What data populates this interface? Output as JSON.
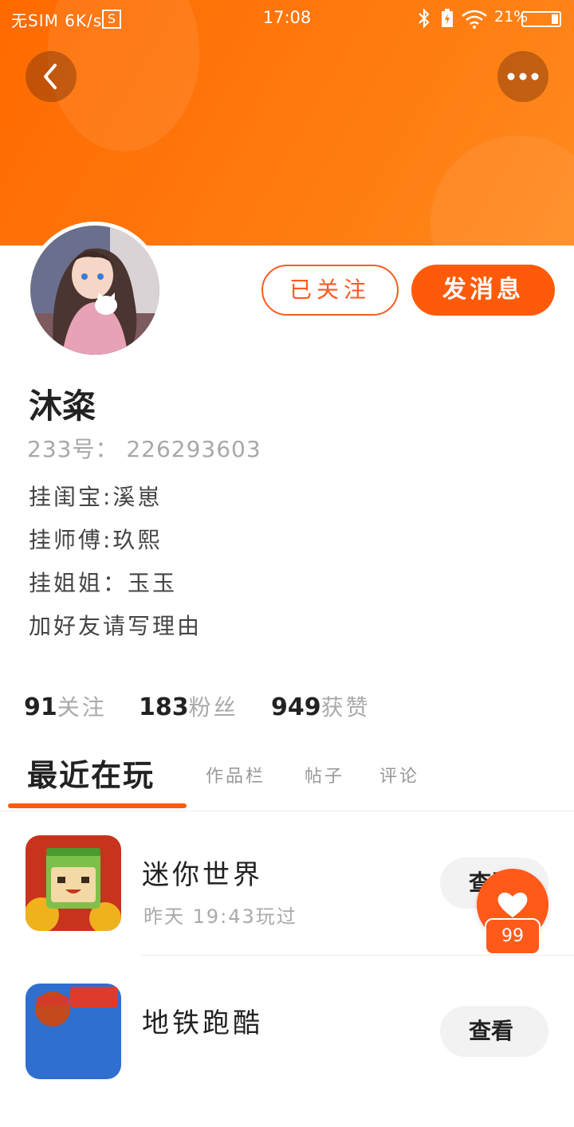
{
  "status_bar": {
    "carrier": "无SIM",
    "speed": "6K/s",
    "sim_badge": "S",
    "time": "17:08",
    "battery_percent": "21%"
  },
  "header": {
    "back_icon": "chevron-left-icon",
    "more_icon": "more-dots-icon",
    "accent_color": "#ff6a00"
  },
  "profile": {
    "followed_label": "已关注",
    "message_label": "发消息",
    "username": "沐粢",
    "user_id_text": "233号：  226293603",
    "bio_lines": [
      "挂闺宝:溪崽",
      "挂师傅:玖熙",
      "挂姐姐：玉玉",
      "加好友请写理由"
    ]
  },
  "stats": {
    "following_count": "91",
    "following_label": "关注",
    "fans_count": "183",
    "fans_label": "粉丝",
    "likes_count": "949",
    "likes_label": "获赞"
  },
  "tabs": [
    "最近在玩",
    "作品栏",
    "帖子",
    "评论"
  ],
  "games": [
    {
      "name": "迷你世界",
      "time": "昨天  19:43玩过",
      "button": "查看"
    },
    {
      "name": "地铁跑酷",
      "time": "",
      "button": "查看"
    }
  ],
  "fab": {
    "icon": "heart-icon",
    "badge": "99"
  }
}
